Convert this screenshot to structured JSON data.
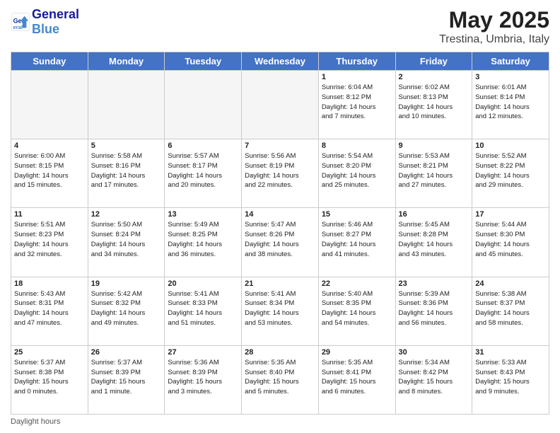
{
  "header": {
    "logo_line1": "General",
    "logo_line2": "Blue",
    "month_title": "May 2025",
    "location": "Trestina, Umbria, Italy"
  },
  "weekdays": [
    "Sunday",
    "Monday",
    "Tuesday",
    "Wednesday",
    "Thursday",
    "Friday",
    "Saturday"
  ],
  "weeks": [
    [
      {
        "day": "",
        "info": ""
      },
      {
        "day": "",
        "info": ""
      },
      {
        "day": "",
        "info": ""
      },
      {
        "day": "",
        "info": ""
      },
      {
        "day": "1",
        "info": "Sunrise: 6:04 AM\nSunset: 8:12 PM\nDaylight: 14 hours\nand 7 minutes."
      },
      {
        "day": "2",
        "info": "Sunrise: 6:02 AM\nSunset: 8:13 PM\nDaylight: 14 hours\nand 10 minutes."
      },
      {
        "day": "3",
        "info": "Sunrise: 6:01 AM\nSunset: 8:14 PM\nDaylight: 14 hours\nand 12 minutes."
      }
    ],
    [
      {
        "day": "4",
        "info": "Sunrise: 6:00 AM\nSunset: 8:15 PM\nDaylight: 14 hours\nand 15 minutes."
      },
      {
        "day": "5",
        "info": "Sunrise: 5:58 AM\nSunset: 8:16 PM\nDaylight: 14 hours\nand 17 minutes."
      },
      {
        "day": "6",
        "info": "Sunrise: 5:57 AM\nSunset: 8:17 PM\nDaylight: 14 hours\nand 20 minutes."
      },
      {
        "day": "7",
        "info": "Sunrise: 5:56 AM\nSunset: 8:19 PM\nDaylight: 14 hours\nand 22 minutes."
      },
      {
        "day": "8",
        "info": "Sunrise: 5:54 AM\nSunset: 8:20 PM\nDaylight: 14 hours\nand 25 minutes."
      },
      {
        "day": "9",
        "info": "Sunrise: 5:53 AM\nSunset: 8:21 PM\nDaylight: 14 hours\nand 27 minutes."
      },
      {
        "day": "10",
        "info": "Sunrise: 5:52 AM\nSunset: 8:22 PM\nDaylight: 14 hours\nand 29 minutes."
      }
    ],
    [
      {
        "day": "11",
        "info": "Sunrise: 5:51 AM\nSunset: 8:23 PM\nDaylight: 14 hours\nand 32 minutes."
      },
      {
        "day": "12",
        "info": "Sunrise: 5:50 AM\nSunset: 8:24 PM\nDaylight: 14 hours\nand 34 minutes."
      },
      {
        "day": "13",
        "info": "Sunrise: 5:49 AM\nSunset: 8:25 PM\nDaylight: 14 hours\nand 36 minutes."
      },
      {
        "day": "14",
        "info": "Sunrise: 5:47 AM\nSunset: 8:26 PM\nDaylight: 14 hours\nand 38 minutes."
      },
      {
        "day": "15",
        "info": "Sunrise: 5:46 AM\nSunset: 8:27 PM\nDaylight: 14 hours\nand 41 minutes."
      },
      {
        "day": "16",
        "info": "Sunrise: 5:45 AM\nSunset: 8:28 PM\nDaylight: 14 hours\nand 43 minutes."
      },
      {
        "day": "17",
        "info": "Sunrise: 5:44 AM\nSunset: 8:30 PM\nDaylight: 14 hours\nand 45 minutes."
      }
    ],
    [
      {
        "day": "18",
        "info": "Sunrise: 5:43 AM\nSunset: 8:31 PM\nDaylight: 14 hours\nand 47 minutes."
      },
      {
        "day": "19",
        "info": "Sunrise: 5:42 AM\nSunset: 8:32 PM\nDaylight: 14 hours\nand 49 minutes."
      },
      {
        "day": "20",
        "info": "Sunrise: 5:41 AM\nSunset: 8:33 PM\nDaylight: 14 hours\nand 51 minutes."
      },
      {
        "day": "21",
        "info": "Sunrise: 5:41 AM\nSunset: 8:34 PM\nDaylight: 14 hours\nand 53 minutes."
      },
      {
        "day": "22",
        "info": "Sunrise: 5:40 AM\nSunset: 8:35 PM\nDaylight: 14 hours\nand 54 minutes."
      },
      {
        "day": "23",
        "info": "Sunrise: 5:39 AM\nSunset: 8:36 PM\nDaylight: 14 hours\nand 56 minutes."
      },
      {
        "day": "24",
        "info": "Sunrise: 5:38 AM\nSunset: 8:37 PM\nDaylight: 14 hours\nand 58 minutes."
      }
    ],
    [
      {
        "day": "25",
        "info": "Sunrise: 5:37 AM\nSunset: 8:38 PM\nDaylight: 15 hours\nand 0 minutes."
      },
      {
        "day": "26",
        "info": "Sunrise: 5:37 AM\nSunset: 8:39 PM\nDaylight: 15 hours\nand 1 minute."
      },
      {
        "day": "27",
        "info": "Sunrise: 5:36 AM\nSunset: 8:39 PM\nDaylight: 15 hours\nand 3 minutes."
      },
      {
        "day": "28",
        "info": "Sunrise: 5:35 AM\nSunset: 8:40 PM\nDaylight: 15 hours\nand 5 minutes."
      },
      {
        "day": "29",
        "info": "Sunrise: 5:35 AM\nSunset: 8:41 PM\nDaylight: 15 hours\nand 6 minutes."
      },
      {
        "day": "30",
        "info": "Sunrise: 5:34 AM\nSunset: 8:42 PM\nDaylight: 15 hours\nand 8 minutes."
      },
      {
        "day": "31",
        "info": "Sunrise: 5:33 AM\nSunset: 8:43 PM\nDaylight: 15 hours\nand 9 minutes."
      }
    ]
  ],
  "footer": {
    "note": "Daylight hours"
  }
}
